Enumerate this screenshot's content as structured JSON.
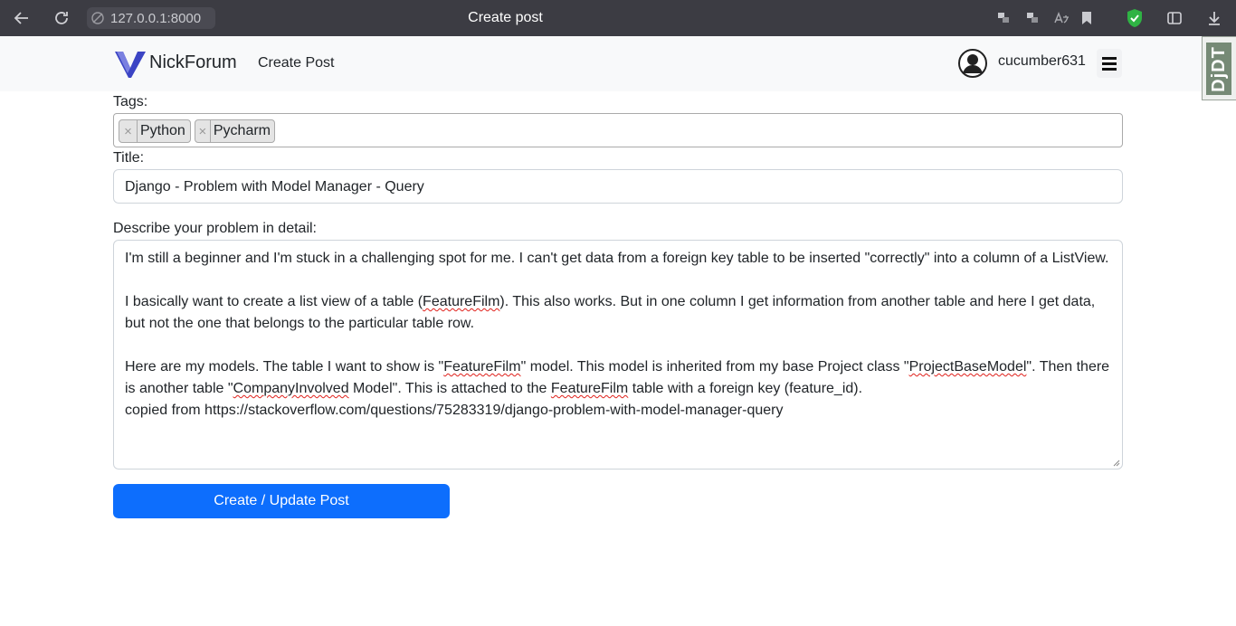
{
  "browser": {
    "url": "127.0.0.1:8000",
    "tab_title": "Create post",
    "icons": [
      "back-icon",
      "reload-icon",
      "site-info-icon",
      "extension-icon",
      "extension-icon",
      "translate-icon",
      "bookmark-icon",
      "shield-extension-icon",
      "sidebar-icon",
      "download-icon"
    ]
  },
  "navbar": {
    "brand": "NickForum",
    "create_post_link": "Create Post",
    "username": "cucumber631",
    "debug_toolbar": "DjDT"
  },
  "form": {
    "tags_label": "Tags:",
    "tags": [
      {
        "label": "Python",
        "remove": "×"
      },
      {
        "label": "Pycharm",
        "remove": "×"
      }
    ],
    "title_label": "Title:",
    "title_value": "Django - Problem with Model Manager - Query",
    "body_label": "Describe your problem in detail:",
    "body": {
      "p1": "I'm still a beginner and I'm stuck in a challenging spot for me. I can't get data from a foreign key table to be inserted \"correctly\" into a column of a ListView.",
      "p2_before": "I basically want to create a list view of a table (",
      "p2_word": "FeatureFilm",
      "p2_after": "). This also works. But in one column I get information from another table and here I get data, but not the one that belongs to the particular table row.",
      "p3_a": "Here are my models. The table I want to show is \"",
      "p3_w1": "FeatureFilm",
      "p3_b": "\" model. This model is inherited from my base Project class \"",
      "p3_w2": "ProjectBaseModel",
      "p3_c": "\". Then there is another table \"",
      "p3_w3": "CompanyInvolved",
      "p3_d": " Model\". This is attached to the ",
      "p3_w4": "FeatureFilm",
      "p3_e": " table with a foreign key (feature_id).",
      "p4": "copied from https://stackoverflow.com/questions/75283319/django-problem-with-model-manager-query"
    },
    "submit_label": "Create / Update Post"
  },
  "colors": {
    "browser_bar": "#3c3c43",
    "navbar_bg": "#f8f9fa",
    "primary_button": "#0d6efd",
    "brand_logo": "#3b44c4",
    "shield_green": "#2fb344"
  }
}
